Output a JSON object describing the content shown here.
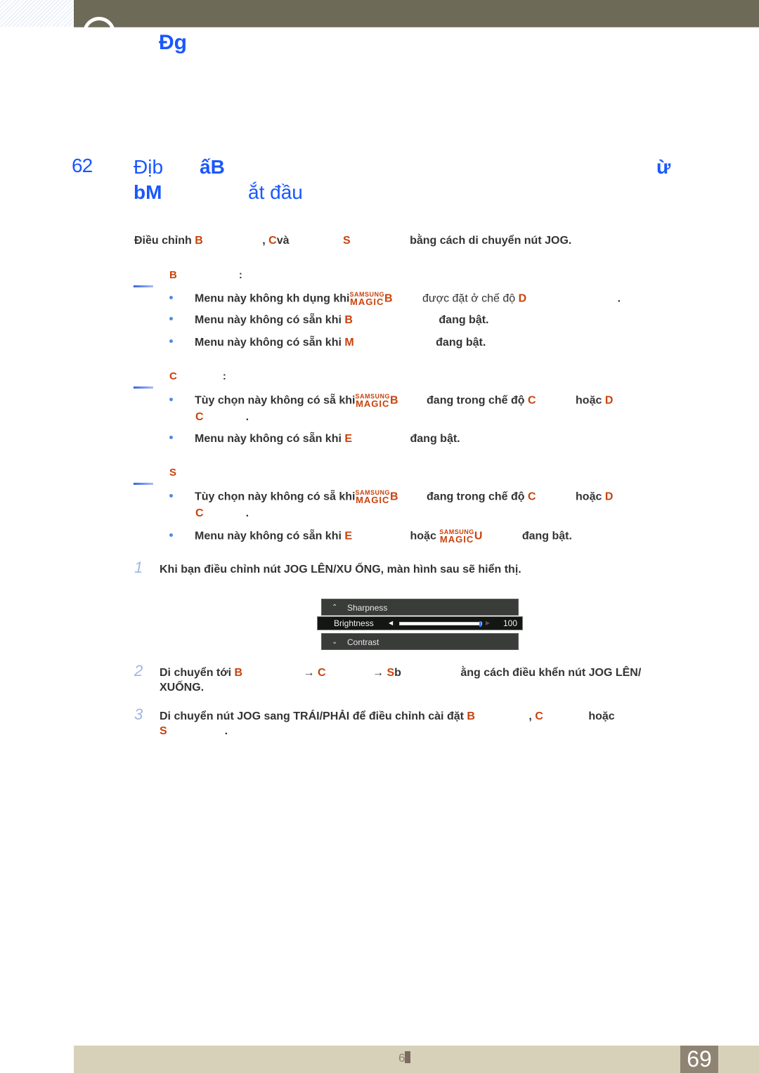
{
  "header": {
    "chapter_title": "Đg"
  },
  "section": {
    "number": "62",
    "title_line1_part1": "Địb",
    "title_line1_part2": "ấB",
    "title_line1_part3": "ừ",
    "title_line2_part1": "bM",
    "title_line2_part2": "ắt đầu"
  },
  "intro": {
    "p1": "Điều chỉnh ",
    "o1": "B",
    "p2": ", ",
    "o2": "C",
    "p3": "và",
    "o3": "S",
    "p4": "bằng cách di chuyển nút JOG."
  },
  "notes": [
    {
      "heading": "B",
      "colon": ":",
      "bullets": [
        {
          "a": "Menu này không kh dụng khi",
          "magic_top": "SAMSUNG",
          "magic_bottom": "MAGIC",
          "o": "B",
          "b": "được đặt ở chế độ",
          "o2": "D",
          "c": "."
        },
        {
          "a": "Menu này không có sẵn khi",
          "o": "B",
          "b": "đang bật."
        },
        {
          "a": "Menu này không có sẵn khi",
          "o": "M",
          "b": "đang bật."
        }
      ]
    },
    {
      "heading": "C",
      "colon": ":",
      "bullets": [
        {
          "a": "Tùy chọn này không có sẵ khi",
          "magic_top": "SAMSUNG",
          "magic_bottom": "MAGIC",
          "o": "B",
          "b": "đang trong chế độ",
          "o2": "C",
          "c": "hoặc",
          "o3": "D",
          "cont_o": "C",
          "cont_end": "."
        },
        {
          "a": "Menu này không có sẵn khi",
          "o": "E",
          "b": "đang bật."
        }
      ]
    },
    {
      "heading": "S",
      "colon": "",
      "bullets": [
        {
          "a": "Tùy chọn này không có sẵ khi",
          "magic_top": "SAMSUNG",
          "magic_bottom": "MAGIC",
          "o": "B",
          "b": "đang trong chế độ",
          "o2": "C",
          "c": "hoặc",
          "o3": "D",
          "cont_o": "C",
          "cont_end": "."
        },
        {
          "a": "Menu này không có sẵn khi",
          "o": "E",
          "b": "hoặc",
          "magic_top": "SAMSUNG",
          "magic_bottom": "MAGIC",
          "o2": "U",
          "c": "đang bật."
        }
      ]
    }
  ],
  "steps": [
    {
      "num": "1",
      "text": "Khi bạn điều chỉnh nút JOG LÊN/XU ỐNG, màn hình sau sẽ hiển thị."
    },
    {
      "num": "2",
      "a": "Di chuyển tới",
      "o1": "B",
      "arrow1": "→",
      "o2": "C",
      "arrow2": "→",
      "o3": "S",
      "b": "b",
      "c": "ằng cách điều khển nút JOG LÊN/",
      "line2": "XUỐNG."
    },
    {
      "num": "3",
      "a": "Di chuyển nút JOG sang TRÁI/PHẢI để điều chỉnh cài đặt",
      "o1": "B",
      "b": ",",
      "o2": "C",
      "c": "hoặc",
      "o3": "S",
      "end": "."
    }
  ],
  "osd": {
    "prev_item": "Sharpness",
    "selected_item": "Brightness",
    "next_item": "Contrast",
    "value": "100",
    "value_fraction": 1.0,
    "prev_icon": "chevron-up-icon",
    "next_icon": "chevron-down-icon"
  },
  "footer": {
    "center_text": "6",
    "page_number": "69"
  },
  "colors": {
    "accent_blue": "#1a57ff",
    "highlight_orange": "#c9420c",
    "header_bar": "#6d6b58",
    "footer_bar": "#d8d1ba",
    "page_box": "#8f8373"
  }
}
